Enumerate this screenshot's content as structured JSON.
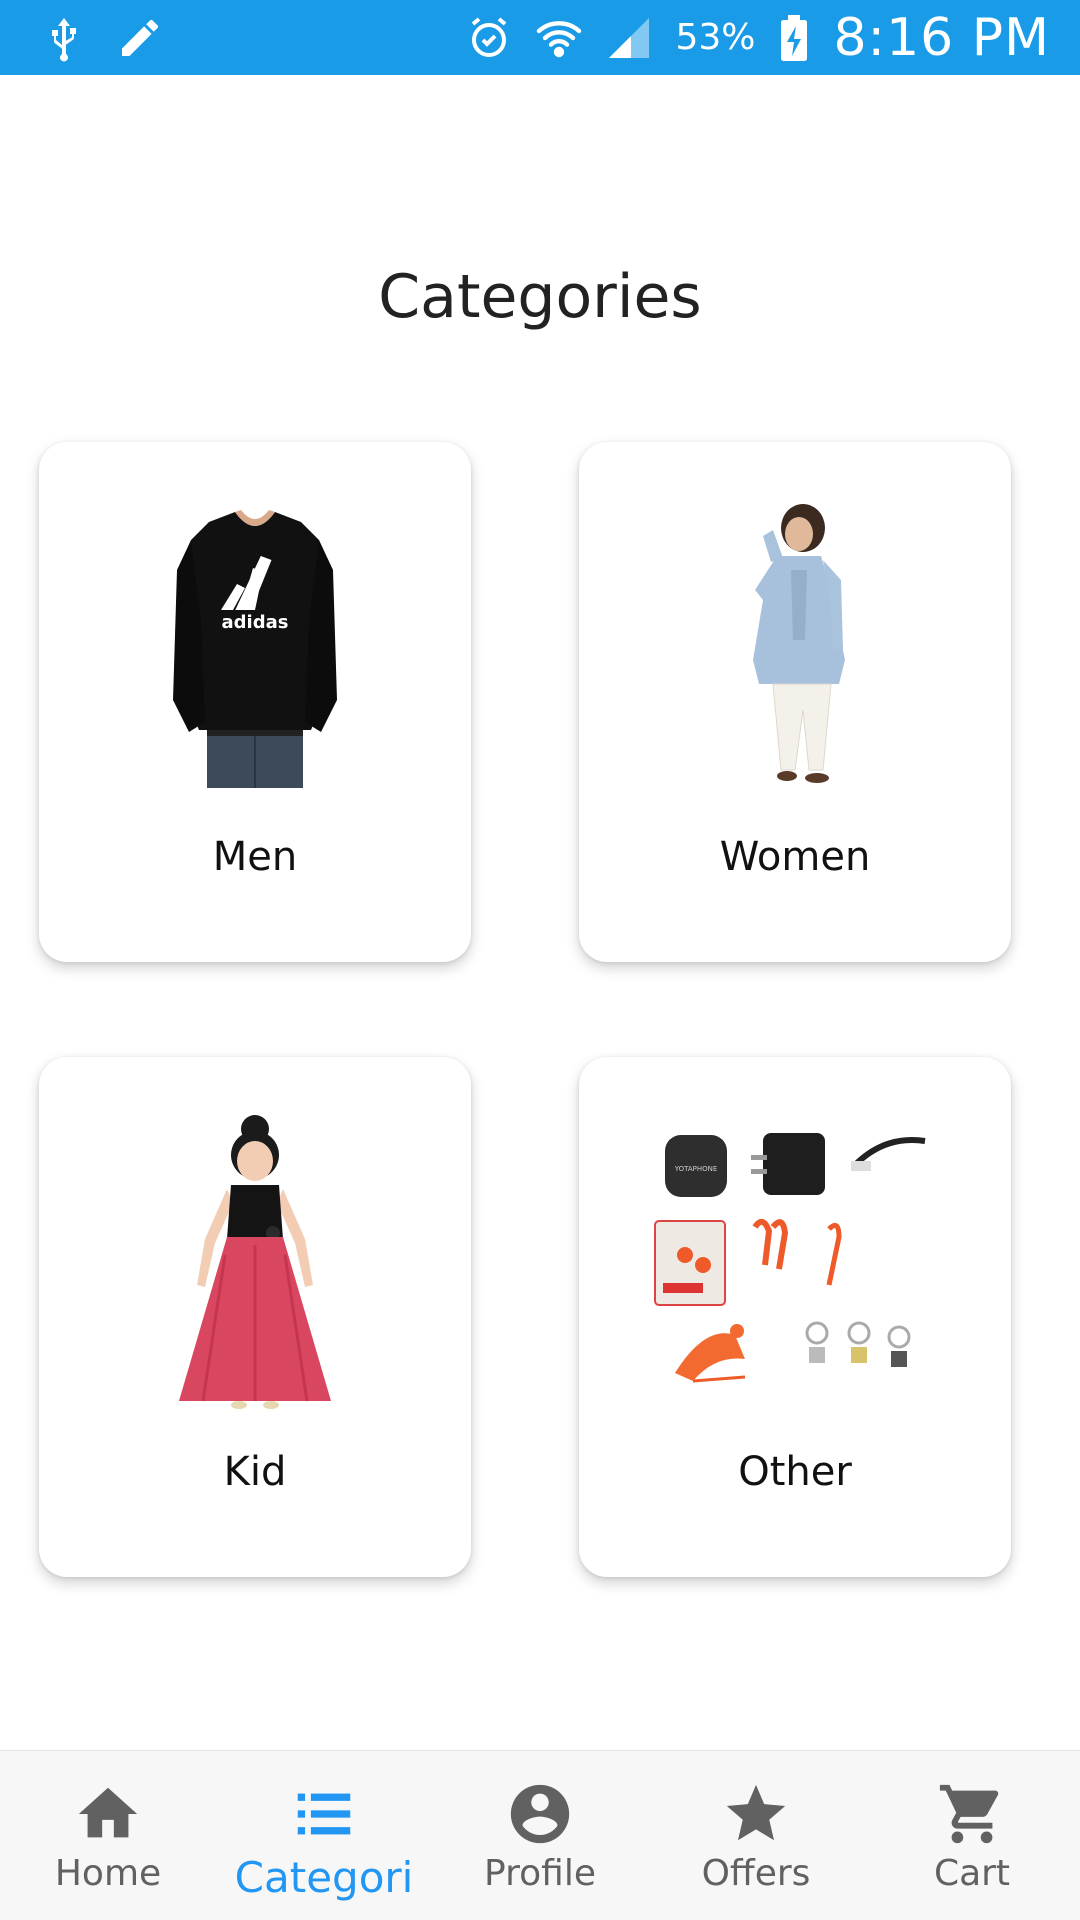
{
  "status_bar": {
    "battery": "53%",
    "time": "8:16 PM",
    "icons": [
      "usb-icon",
      "edit-icon",
      "alarm-icon",
      "wifi-icon",
      "signal-icon",
      "battery-charging-icon"
    ]
  },
  "page": {
    "title": "Categories"
  },
  "categories": [
    {
      "label": "Men",
      "image": "black-tshirt-image"
    },
    {
      "label": "Women",
      "image": "woman-tunic-image"
    },
    {
      "label": "Kid",
      "image": "girl-dress-image"
    },
    {
      "label": "Other",
      "image": "accessories-image"
    }
  ],
  "bottom_nav": {
    "items": [
      {
        "label": "Home",
        "icon": "home-icon"
      },
      {
        "label": "Categori",
        "icon": "list-icon"
      },
      {
        "label": "Profile",
        "icon": "account-circle-icon"
      },
      {
        "label": "Offers",
        "icon": "star-icon"
      },
      {
        "label": "Cart",
        "icon": "cart-icon"
      }
    ],
    "active_index": 1
  },
  "colors": {
    "status_bar": "#1a9be8",
    "accent": "#2196f3",
    "nav_inactive": "#616161"
  }
}
